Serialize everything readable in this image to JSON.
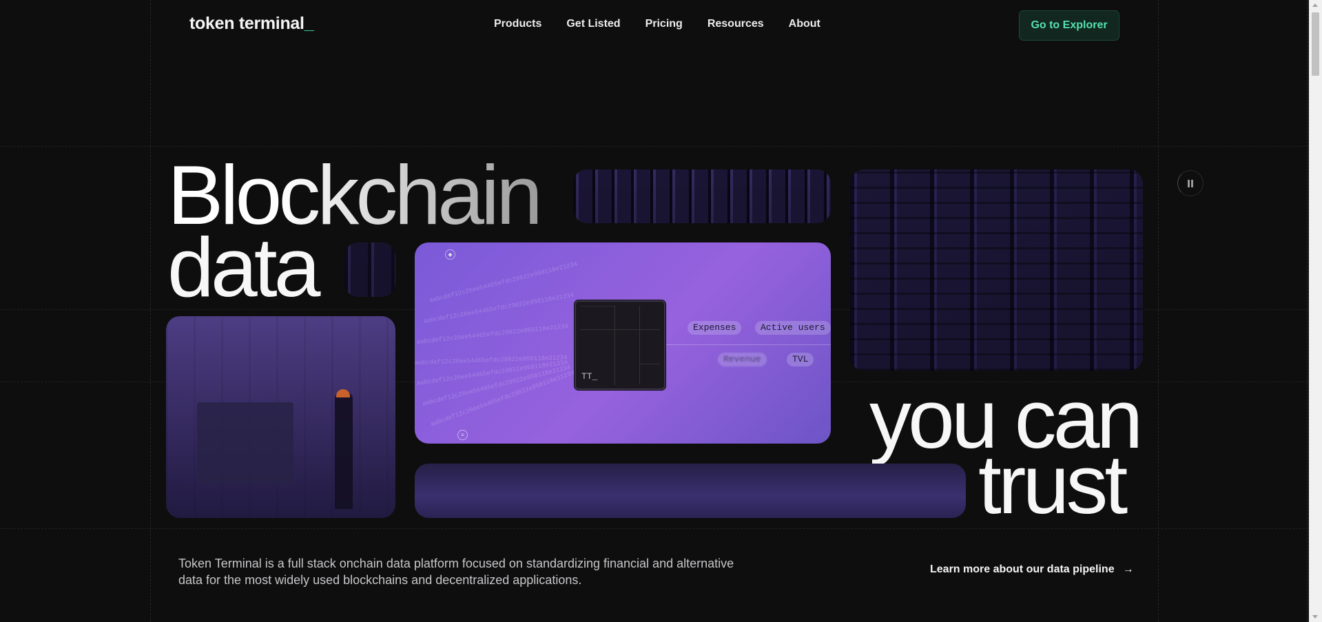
{
  "header": {
    "logo_text": "token terminal",
    "logo_cursor": "_",
    "nav": [
      "Products",
      "Get Listed",
      "Pricing",
      "Resources",
      "About"
    ],
    "cta_label": "Go to Explorer"
  },
  "hero": {
    "line1": "Blockchain",
    "line2": "data",
    "line3": "you can",
    "line4": "trust",
    "chip_label": "TT_",
    "pills": [
      "Expenses",
      "Active users",
      "Revenue",
      "TVL"
    ],
    "stream_text": "aabcdef12c26ee54465efdc29822e950118e21234",
    "pause_icon": "pause-icon"
  },
  "footer_intro": {
    "description": "Token Terminal is a full stack onchain data platform focused on standardizing financial and alternative data for the most widely used blockchains and decentralized applications.",
    "link_label": "Learn more about our data pipeline",
    "link_icon": "arrow-right-icon"
  },
  "colors": {
    "background": "#0e0e0f",
    "accent": "#55e1b0",
    "purple_card": "#9762de"
  }
}
